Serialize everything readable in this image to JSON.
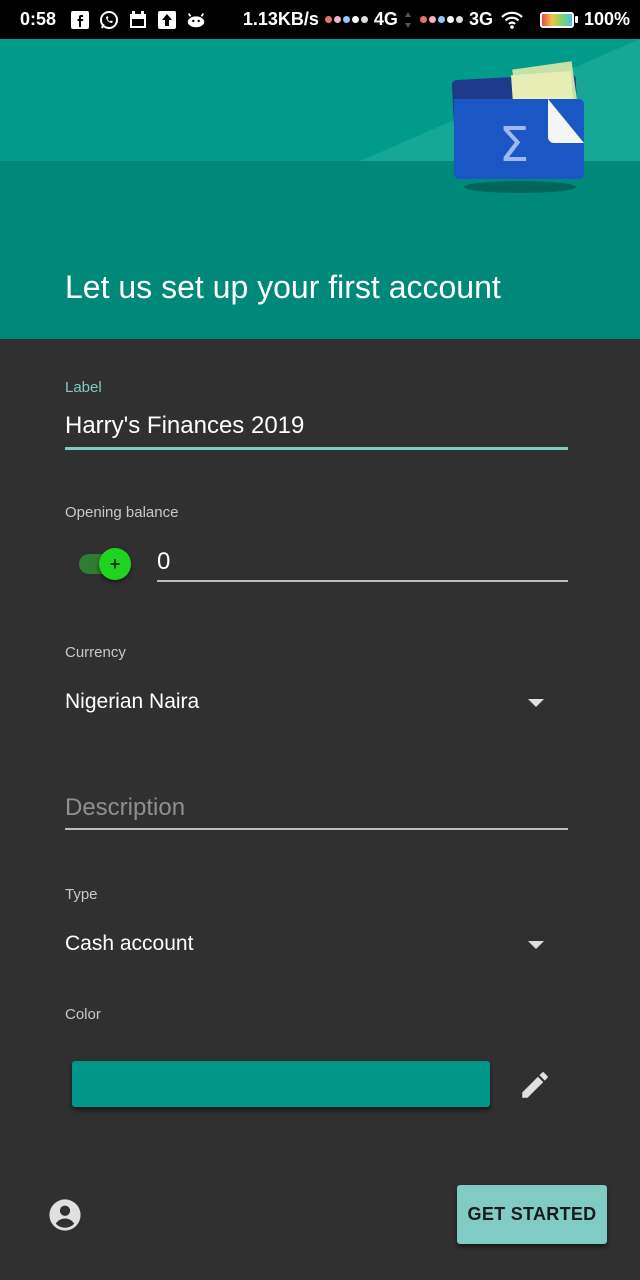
{
  "status_bar": {
    "time": "0:58",
    "net_speed": "1.13KB/s",
    "sim1_type": "4G",
    "sim2_type": "3G",
    "battery": "100%"
  },
  "header": {
    "title": "Let us set up your first account",
    "logo_symbol": "Σ"
  },
  "form": {
    "label_field": {
      "label": "Label",
      "value": "Harry's  Finances 2019"
    },
    "opening_balance": {
      "label": "Opening balance",
      "toggle_symbol": "+",
      "value": "0"
    },
    "currency": {
      "label": "Currency",
      "selected": "Nigerian Naira"
    },
    "description": {
      "placeholder": "Description",
      "value": ""
    },
    "type": {
      "label": "Type",
      "selected": "Cash account"
    },
    "color": {
      "label": "Color",
      "value": "#009688"
    }
  },
  "footer": {
    "get_started_label": "GET STARTED",
    "account_icon": "account-circle-icon"
  },
  "colors": {
    "primary": "#009688",
    "accent": "#80cbc4",
    "toggle_on": "#21d321",
    "background": "#303030"
  }
}
